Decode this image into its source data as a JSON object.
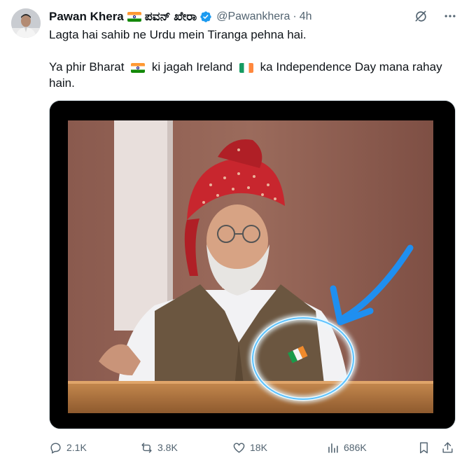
{
  "author": {
    "name": "Pawan Khera",
    "alt_name": "ಪವನ್ ಖೇರಾ",
    "handle": "@Pawankhera",
    "separator": "·",
    "time": "4h",
    "verified": true
  },
  "tweet": {
    "line1": "Lagta hai sahib ne Urdu mein Tiranga pehna hai.",
    "line2_part1": "Ya phir Bharat",
    "line2_part2": "ki jagah Ireland",
    "line2_part3": "ka Independence Day mana rahay hain."
  },
  "actions": {
    "replies": "2.1K",
    "reposts": "3.8K",
    "likes": "18K",
    "views": "686K"
  },
  "colors": {
    "accent": "#1d9bf0",
    "muted": "#536471",
    "text": "#0f1419",
    "highlight_glow": "#7fd0ff"
  },
  "icons": [
    "grok-icon",
    "more-icon",
    "reply-icon",
    "repost-icon",
    "like-icon",
    "views-icon",
    "bookmark-icon",
    "share-icon",
    "verified-icon"
  ]
}
